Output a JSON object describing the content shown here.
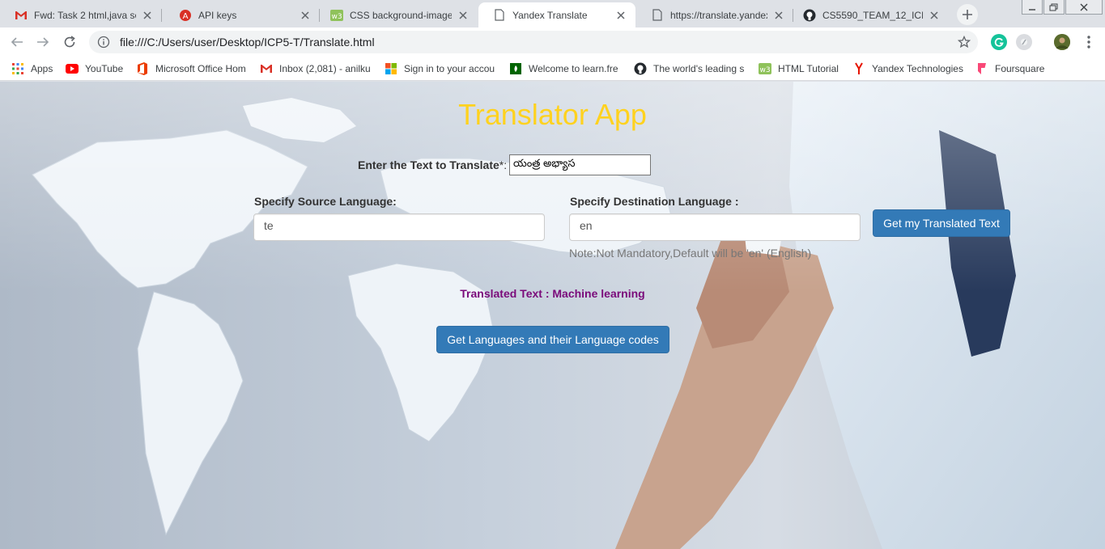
{
  "browser": {
    "tabs": [
      {
        "title": "Fwd: Task 2 html,java scr",
        "icon": "gmail-icon",
        "active": false
      },
      {
        "title": "API keys",
        "icon": "api-keys-icon",
        "active": false
      },
      {
        "title": "CSS background-image",
        "icon": "w3schools-icon",
        "active": false
      },
      {
        "title": "Yandex Translate",
        "icon": "page-icon",
        "active": true
      },
      {
        "title": "https://translate.yandex.",
        "icon": "page-icon",
        "active": false
      },
      {
        "title": "CS5590_TEAM_12_ICP/IC",
        "icon": "github-icon",
        "active": false
      }
    ],
    "url": "file:///C:/Users/user/Desktop/ICP5-T/Translate.html",
    "bookmarks": [
      {
        "label": "Apps",
        "icon": "apps-grid-icon"
      },
      {
        "label": "YouTube",
        "icon": "youtube-icon"
      },
      {
        "label": "Microsoft Office Hom",
        "icon": "office-icon"
      },
      {
        "label": "Inbox (2,081) - anilku",
        "icon": "gmail-icon"
      },
      {
        "label": "Sign in to your accou",
        "icon": "microsoft-icon"
      },
      {
        "label": "Welcome to learn.fre",
        "icon": "freecodecamp-icon"
      },
      {
        "label": "The world's leading s",
        "icon": "github-icon"
      },
      {
        "label": "HTML Tutorial",
        "icon": "w3schools-icon"
      },
      {
        "label": "Yandex Technologies",
        "icon": "yandex-icon"
      },
      {
        "label": "Foursquare",
        "icon": "foursquare-icon"
      }
    ]
  },
  "app": {
    "title": "Translator App",
    "text_label": "Enter the Text to Translate",
    "text_required": "*:",
    "text_value": "యంత్ర అభ్యాస",
    "source_label": "Specify Source Language:",
    "source_value": "te",
    "dest_label": "Specify Destination Language :",
    "dest_value": "en",
    "translate_button": "Get my Translated Text",
    "note": "Note:Not Mandatory,Default will be 'en' (English)",
    "result": "Translated Text : Machine learning",
    "languages_button": "Get Languages and their Language codes"
  },
  "colors": {
    "title": "#ffd21f",
    "button": "#337ab7",
    "result": "#7a0a7a"
  }
}
